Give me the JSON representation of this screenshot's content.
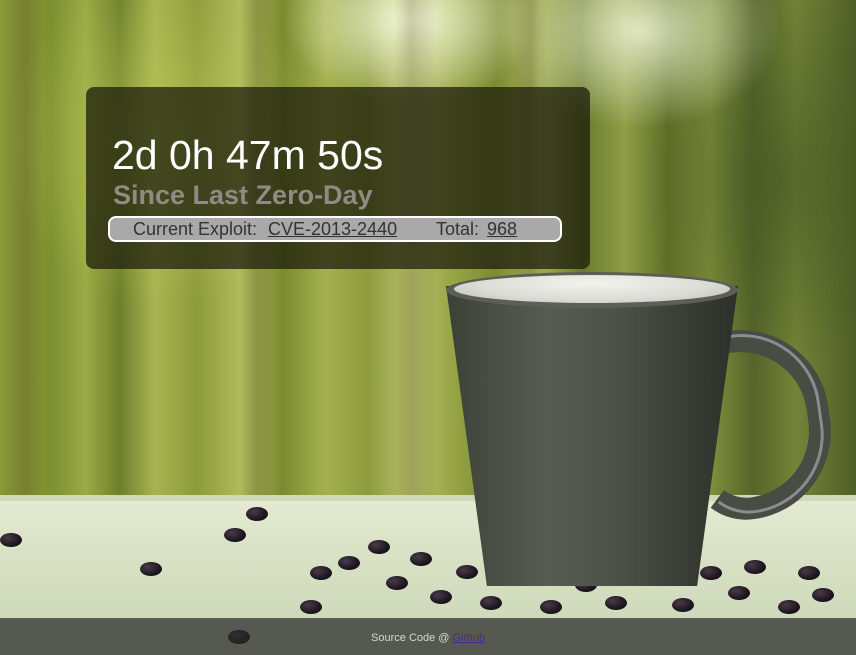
{
  "counter": {
    "elapsed": "2d 0h 47m 50s",
    "subtitle": "Since Last Zero-Day",
    "exploit_label": "Current Exploit:",
    "exploit_id": "CVE-2013-2440",
    "total_label": "Total:",
    "total_value": "968"
  },
  "footer": {
    "source_text": "Source Code @ ",
    "source_link": "Github"
  },
  "colors": {
    "panel_bg": "#19190a",
    "timer_text": "#ffffff",
    "subtitle_text": "#8d8c84",
    "exploit_bar_bg": "#a9a9a9",
    "footer_link": "#4b2a8c"
  }
}
